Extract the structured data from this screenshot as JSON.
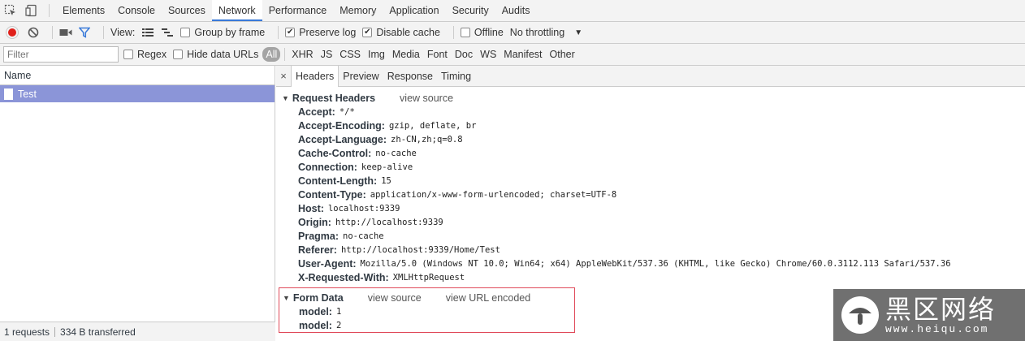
{
  "devtools": {
    "tabs": [
      "Elements",
      "Console",
      "Sources",
      "Network",
      "Performance",
      "Memory",
      "Application",
      "Security",
      "Audits"
    ],
    "active_tab": "Network"
  },
  "toolbar": {
    "view_label": "View:",
    "group_by_frame": "Group by frame",
    "preserve_log": "Preserve log",
    "disable_cache": "Disable cache",
    "offline": "Offline",
    "throttling": "No throttling"
  },
  "filterbar": {
    "filter_placeholder": "Filter",
    "regex": "Regex",
    "hide_data_urls": "Hide data URLs",
    "types": [
      "All",
      "XHR",
      "JS",
      "CSS",
      "Img",
      "Media",
      "Font",
      "Doc",
      "WS",
      "Manifest",
      "Other"
    ]
  },
  "request_list": {
    "column_name": "Name",
    "requests": [
      {
        "name": "Test",
        "selected": true
      }
    ]
  },
  "status_bar": {
    "requests": "1 requests",
    "transferred": "334 B transferred"
  },
  "detail": {
    "close": "×",
    "tabs": [
      "Headers",
      "Preview",
      "Response",
      "Timing"
    ],
    "active_tab": "Headers",
    "request_headers": {
      "title": "Request Headers",
      "view_source": "view source",
      "items": [
        {
          "name": "Accept:",
          "value": "*/*"
        },
        {
          "name": "Accept-Encoding:",
          "value": "gzip, deflate, br"
        },
        {
          "name": "Accept-Language:",
          "value": "zh-CN,zh;q=0.8"
        },
        {
          "name": "Cache-Control:",
          "value": "no-cache"
        },
        {
          "name": "Connection:",
          "value": "keep-alive"
        },
        {
          "name": "Content-Length:",
          "value": "15"
        },
        {
          "name": "Content-Type:",
          "value": "application/x-www-form-urlencoded; charset=UTF-8"
        },
        {
          "name": "Host:",
          "value": "localhost:9339"
        },
        {
          "name": "Origin:",
          "value": "http://localhost:9339"
        },
        {
          "name": "Pragma:",
          "value": "no-cache"
        },
        {
          "name": "Referer:",
          "value": "http://localhost:9339/Home/Test"
        },
        {
          "name": "User-Agent:",
          "value": "Mozilla/5.0 (Windows NT 10.0; Win64; x64) AppleWebKit/537.36 (KHTML, like Gecko) Chrome/60.0.3112.113 Safari/537.36"
        },
        {
          "name": "X-Requested-With:",
          "value": "XMLHttpRequest"
        }
      ]
    },
    "form_data": {
      "title": "Form Data",
      "view_source": "view source",
      "view_url_encoded": "view URL encoded",
      "items": [
        {
          "name": "model:",
          "value": "1"
        },
        {
          "name": "model:",
          "value": "2"
        }
      ]
    }
  },
  "watermark": {
    "brand_cn": "黑区网络",
    "url": "www.heiqu.com"
  },
  "colors": {
    "accent": "#3879d9",
    "selected_row": "#8b95d8",
    "record": "#e0201b",
    "highlight_box": "#e04a5a"
  }
}
